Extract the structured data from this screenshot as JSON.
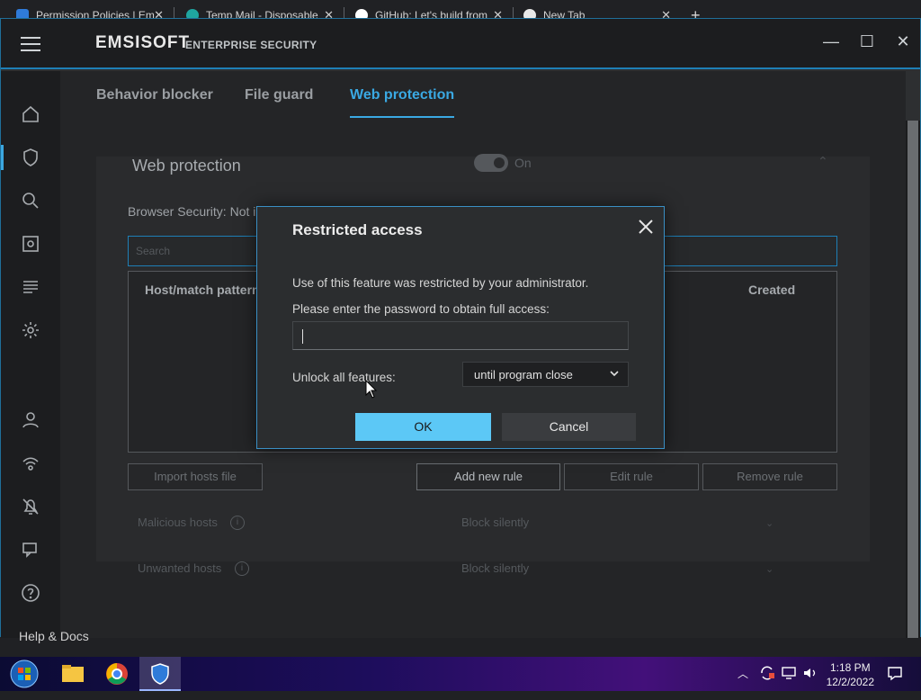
{
  "browser_tabs": [
    {
      "title": "Permission Policies | Em",
      "favicon_color": "#2f7bd9"
    },
    {
      "title": "Temp Mail - Disposable",
      "favicon_color": "#1fa5a0"
    },
    {
      "title": "GitHub: Let's build from",
      "favicon_color": "#ffffff"
    },
    {
      "title": "New Tab",
      "favicon_color": "#ffffff"
    }
  ],
  "app": {
    "brand": "EMSISOFT",
    "subtitle": "ENTERPRISE SECURITY"
  },
  "sidebar": {
    "icons": [
      "home-icon",
      "shield-icon",
      "search-icon",
      "scan-icon",
      "logs-icon",
      "settings-icon",
      "user-icon",
      "network-icon",
      "notifications-off-icon",
      "chat-icon",
      "help-icon"
    ]
  },
  "tabs": [
    "Behavior blocker",
    "File guard",
    "Web protection"
  ],
  "active_tab": "Web protection",
  "section": {
    "title": "Web protection",
    "toggle_label": "On",
    "browser_security": "Browser Security: Not in",
    "search_placeholder": "Search",
    "table_headers": [
      "Host/match pattern",
      "Created"
    ],
    "buttons": {
      "import": "Import hosts file",
      "add": "Add new rule",
      "edit": "Edit rule",
      "remove": "Remove rule"
    },
    "rows": [
      {
        "label": "Malicious hosts",
        "value": "Block silently"
      },
      {
        "label": "Unwanted hosts",
        "value": "Block silently"
      }
    ],
    "help_text": "Help & Docs"
  },
  "dialog": {
    "title": "Restricted access",
    "message": "Use of this feature was restricted by your administrator.",
    "prompt": "Please enter the password to obtain full access:",
    "password_value": "",
    "unlock_label": "Unlock all features:",
    "unlock_option": "until program close",
    "ok_label": "OK",
    "cancel_label": "Cancel"
  },
  "taskbar": {
    "time": "1:18 PM",
    "date": "12/2/2022"
  },
  "colors": {
    "accent": "#3aa9e3",
    "ok_button": "#5cc8f6"
  }
}
